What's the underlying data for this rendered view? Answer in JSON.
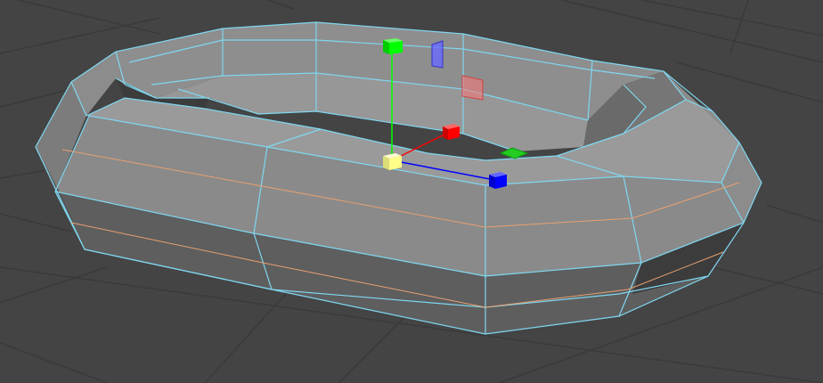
{
  "viewport": {
    "background": "#444444",
    "grid_color": "#3a3a3a",
    "wireframe_color": "#7fd7f0",
    "edge_loop_color": "#e8a070",
    "face_colors": {
      "light": "#9a9a9a",
      "mid": "#8a8a8a",
      "dark": "#5e5e5e",
      "shadow": "#3c3c3c"
    }
  },
  "manipulator": {
    "y_axis": {
      "name": "y-axis-handle",
      "color": "#00ff00"
    },
    "x_axis": {
      "name": "x-axis-handle",
      "color": "#ff0000"
    },
    "z_axis": {
      "name": "z-axis-handle",
      "color": "#0000ff"
    },
    "center": {
      "name": "center-handle",
      "color": "#ffff88"
    },
    "plane_xy": {
      "color": "#6a6aff"
    },
    "plane_yz": {
      "color": "#ff7777"
    },
    "plane_xz": {
      "color": "#22cc22"
    }
  }
}
